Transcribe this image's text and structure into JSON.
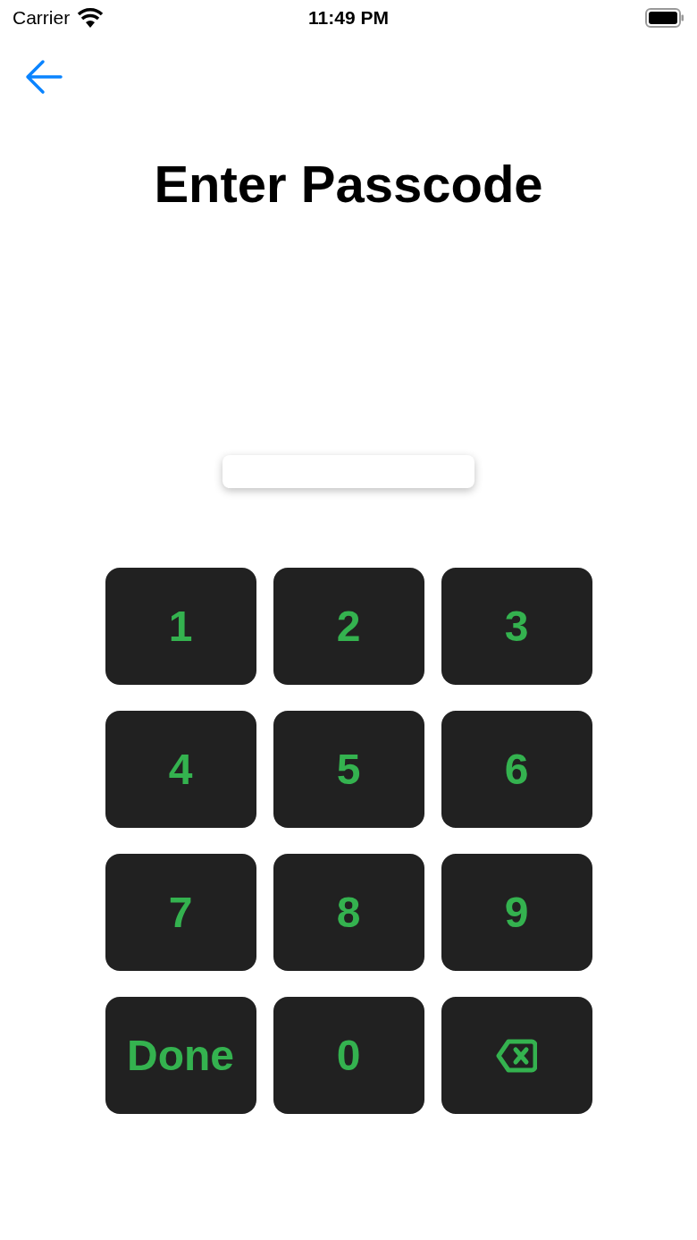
{
  "status_bar": {
    "carrier": "Carrier",
    "time": "11:49 PM"
  },
  "title": "Enter Passcode",
  "keys": [
    {
      "kind": "digit",
      "label": "1"
    },
    {
      "kind": "digit",
      "label": "2"
    },
    {
      "kind": "digit",
      "label": "3"
    },
    {
      "kind": "digit",
      "label": "4"
    },
    {
      "kind": "digit",
      "label": "5"
    },
    {
      "kind": "digit",
      "label": "6"
    },
    {
      "kind": "digit",
      "label": "7"
    },
    {
      "kind": "digit",
      "label": "8"
    },
    {
      "kind": "digit",
      "label": "9"
    },
    {
      "kind": "done",
      "label": "Done"
    },
    {
      "kind": "digit",
      "label": "0"
    },
    {
      "kind": "delete"
    }
  ]
}
